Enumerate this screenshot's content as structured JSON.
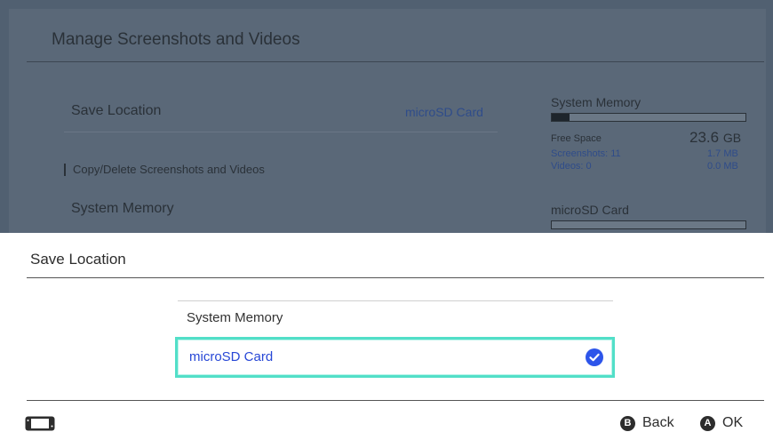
{
  "background": {
    "title": "Manage Screenshots and Videos",
    "rows": {
      "save_location_label": "Save Location",
      "save_location_value": "microSD Card",
      "section_label": "Copy/Delete Screenshots and Videos",
      "system_memory_label": "System Memory"
    },
    "storage": {
      "system_memory": {
        "title": "System Memory",
        "usage_fraction": 0.09,
        "free_space_label": "Free Space",
        "free_space_value": "23.6",
        "free_space_unit": "GB",
        "screenshots_label": "Screenshots: 11",
        "screenshots_size": "1.7 MB",
        "videos_label": "Videos: 0",
        "videos_size": "0.0 MB"
      },
      "microsd": {
        "title": "microSD Card",
        "usage_fraction": 0.0
      }
    }
  },
  "dialog": {
    "title": "Save Location",
    "options": [
      {
        "label": "System Memory",
        "selected": false
      },
      {
        "label": "microSD Card",
        "selected": true
      }
    ],
    "footer": {
      "back_glyph": "B",
      "back_label": "Back",
      "ok_glyph": "A",
      "ok_label": "OK",
      "device_icon": "handheld-console-icon"
    }
  },
  "colors": {
    "highlight": "#52dfc8",
    "selected_text": "#2747d6",
    "check": "#2d55ea"
  }
}
